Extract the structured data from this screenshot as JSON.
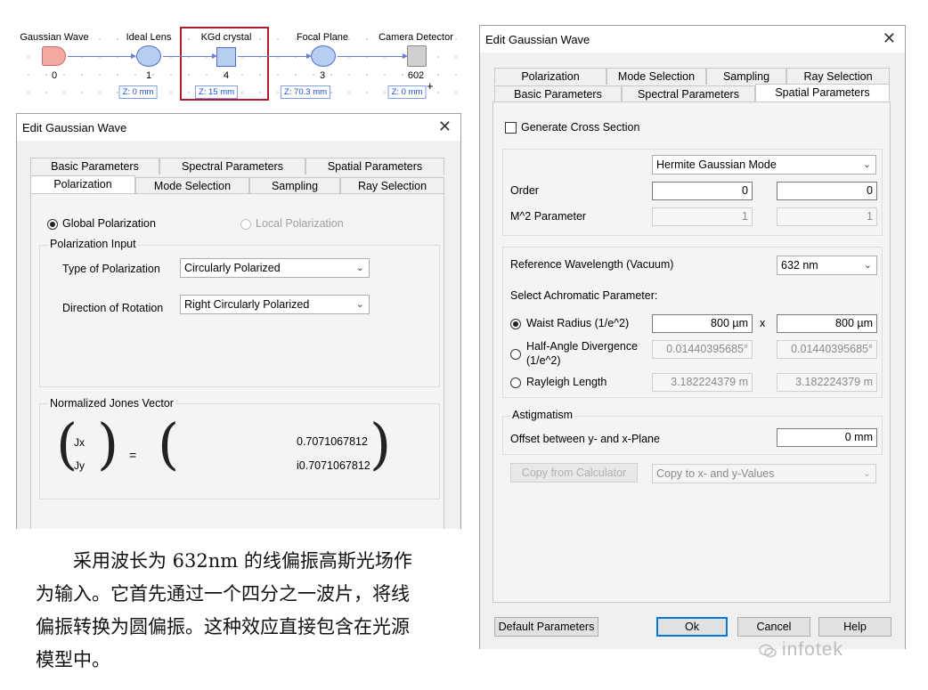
{
  "flow": {
    "nodes": [
      {
        "label": "Gaussian Wave",
        "index": "0"
      },
      {
        "label": "Ideal Lens",
        "index": "1",
        "z": "Z: 0 mm"
      },
      {
        "label": "KGd crystal",
        "index": "4",
        "z": "Z: 15 mm"
      },
      {
        "label": "Focal Plane",
        "index": "3",
        "z": "Z: 70.3 mm"
      },
      {
        "label": "Camera Detector",
        "index": "602",
        "z": "Z: 0 mm"
      }
    ],
    "plus": "+",
    "highlight_color": "#b01c2e"
  },
  "left_dialog": {
    "title": "Edit Gaussian Wave",
    "close": "✕",
    "tabs_row1": [
      "Basic Parameters",
      "Spectral Parameters",
      "Spatial Parameters"
    ],
    "tabs_row2": [
      "Polarization",
      "Mode Selection",
      "Sampling",
      "Ray Selection"
    ],
    "active_tab": "Polarization",
    "global_polarization": "Global Polarization",
    "local_polarization": "Local Polarization",
    "polarization_input_title": "Polarization Input",
    "type_label": "Type of Polarization",
    "type_value": "Circularly Polarized",
    "direction_label": "Direction of Rotation",
    "direction_value": "Right Circularly Polarized",
    "jones_title": "Normalized Jones Vector",
    "jx": "Jx",
    "jy": "Jy",
    "equals": "=",
    "val1": "0.7071067812",
    "val2": "i0.7071067812"
  },
  "right_dialog": {
    "title": "Edit Gaussian Wave",
    "close": "✕",
    "tabs_row1": [
      "Polarization",
      "Mode Selection",
      "Sampling",
      "Ray Selection"
    ],
    "tabs_row2": [
      "Basic Parameters",
      "Spectral Parameters",
      "Spatial Parameters"
    ],
    "active_tab": "Spatial Parameters",
    "generate_cross_section": "Generate Cross Section",
    "mode_value": "Hermite Gaussian Mode",
    "order_label": "Order",
    "order_x": "0",
    "order_y": "0",
    "m2_label": "M^2 Parameter",
    "m2_x": "1",
    "m2_y": "1",
    "ref_wavelength_label": "Reference Wavelength (Vacuum)",
    "ref_wavelength_value": "632 nm",
    "achromatic_label": "Select Achromatic Parameter:",
    "waist_label": "Waist Radius (1/e^2)",
    "waist_x": "800 µm",
    "waist_y": "800 µm",
    "x_sep": "x",
    "half_angle_label_1": "Half-Angle Divergence",
    "half_angle_label_2": "(1/e^2)",
    "half_angle_x": "0.01440395685°",
    "half_angle_y": "0.01440395685°",
    "rayleigh_label": "Rayleigh Length",
    "rayleigh_x": "3.182224379 m",
    "rayleigh_y": "3.182224379 m",
    "astigmatism_title": "Astigmatism",
    "offset_label": "Offset between y- and x-Plane",
    "offset_value": "0 mm",
    "copy_from_calc": "Copy from Calculator",
    "copy_to_xy": "Copy to x- and y-Values",
    "buttons": {
      "default_params": "Default Parameters",
      "ok": "Ok",
      "cancel": "Cancel",
      "help": "Help"
    }
  },
  "caption_lines": [
    "采用波长为 632nm 的线偏振高斯光场作",
    "为输入。它首先通过一个四分之一波片，将线",
    "偏振转换为圆偏振。这种效应直接包含在光源",
    "模型中。"
  ],
  "watermark": "infotek"
}
